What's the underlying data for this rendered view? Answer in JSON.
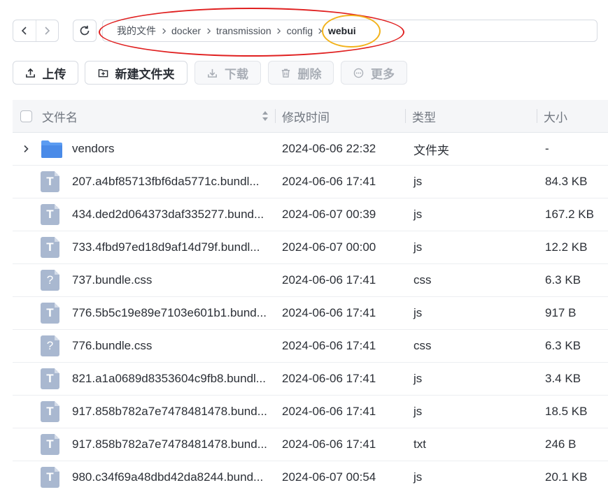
{
  "breadcrumb": {
    "items": [
      "我的文件",
      "docker",
      "transmission",
      "config",
      "webui"
    ]
  },
  "toolbar": {
    "upload_label": "上传",
    "new_folder_label": "新建文件夹",
    "download_label": "下载",
    "delete_label": "删除",
    "more_label": "更多"
  },
  "table": {
    "headers": {
      "name": "文件名",
      "mtime": "修改时间",
      "type": "类型",
      "size": "大小"
    },
    "rows": [
      {
        "name": "vendors",
        "mtime": "2024-06-06 22:32",
        "type": "文件夹",
        "size": "-",
        "icon": "folder-icon"
      },
      {
        "name": "207.a4bf85713fbf6da5771c.bundl...",
        "mtime": "2024-06-06 17:41",
        "type": "js",
        "size": "84.3 KB",
        "icon": "text-file-icon"
      },
      {
        "name": "434.ded2d064373daf335277.bund...",
        "mtime": "2024-06-07 00:39",
        "type": "js",
        "size": "167.2 KB",
        "icon": "text-file-icon"
      },
      {
        "name": "733.4fbd97ed18d9af14d79f.bundl...",
        "mtime": "2024-06-07 00:00",
        "type": "js",
        "size": "12.2 KB",
        "icon": "text-file-icon"
      },
      {
        "name": "737.bundle.css",
        "mtime": "2024-06-06 17:41",
        "type": "css",
        "size": "6.3 KB",
        "icon": "unknown-file-icon"
      },
      {
        "name": "776.5b5c19e89e7103e601b1.bund...",
        "mtime": "2024-06-06 17:41",
        "type": "js",
        "size": "917 B",
        "icon": "text-file-icon"
      },
      {
        "name": "776.bundle.css",
        "mtime": "2024-06-06 17:41",
        "type": "css",
        "size": "6.3 KB",
        "icon": "unknown-file-icon"
      },
      {
        "name": "821.a1a0689d8353604c9fb8.bundl...",
        "mtime": "2024-06-06 17:41",
        "type": "js",
        "size": "3.4 KB",
        "icon": "text-file-icon"
      },
      {
        "name": "917.858b782a7e7478481478.bund...",
        "mtime": "2024-06-06 17:41",
        "type": "js",
        "size": "18.5 KB",
        "icon": "text-file-icon"
      },
      {
        "name": "917.858b782a7e7478481478.bund...",
        "mtime": "2024-06-06 17:41",
        "type": "txt",
        "size": "246 B",
        "icon": "text-file-icon"
      },
      {
        "name": "980.c34f69a48dbd42da8244.bund...",
        "mtime": "2024-06-07 00:54",
        "type": "js",
        "size": "20.1 KB",
        "icon": "text-file-icon"
      }
    ]
  },
  "colors": {
    "annotation_red": "#e02020",
    "annotation_yellow": "#f2b21b",
    "folder": "#5b9cf2",
    "file_icon": "#a9b8d0"
  }
}
